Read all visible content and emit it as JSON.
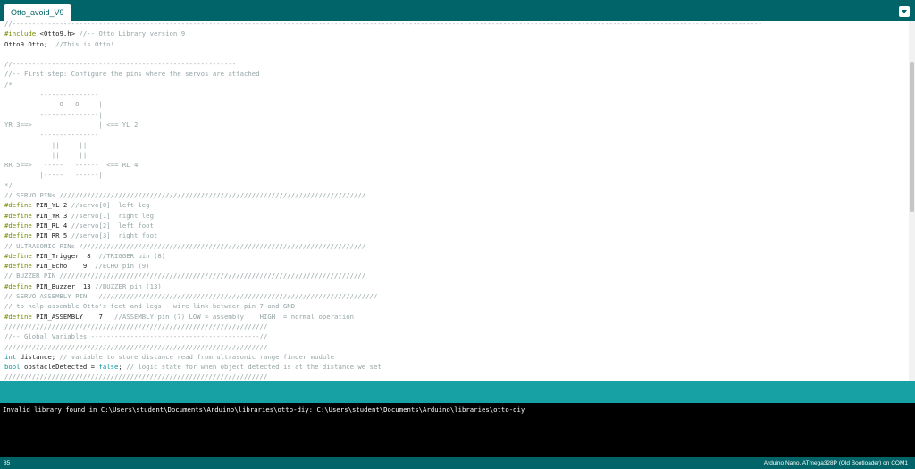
{
  "tab": {
    "title": "Otto_avoid_V9"
  },
  "editor": {
    "lines": [
      [
        {
          "t": "//-----------------------------------------------------------------------------------------------------------------------------------------------------------------------------------------------",
          "c": "cm"
        }
      ],
      [
        {
          "t": "#include ",
          "c": "kw"
        },
        {
          "t": "<Otto9.h>",
          "c": ""
        },
        {
          "t": " //-- Otto Library version 9",
          "c": "cm"
        }
      ],
      [
        {
          "t": "Otto9 Otto;  ",
          "c": ""
        },
        {
          "t": "//This is Otto!",
          "c": "cm"
        }
      ],
      [],
      [
        {
          "t": "//---------------------------------------------------------",
          "c": "cm"
        }
      ],
      [
        {
          "t": "//-- First step: Configure the pins where the servos are attached",
          "c": "cm"
        }
      ],
      [
        {
          "t": "/*",
          "c": "cm"
        }
      ],
      [
        {
          "t": "         ---------------",
          "c": "cm"
        }
      ],
      [
        {
          "t": "        |     O   O     |",
          "c": "cm"
        }
      ],
      [
        {
          "t": "        |---------------|",
          "c": "cm"
        }
      ],
      [
        {
          "t": "YR 3==> |               | <== YL 2",
          "c": "cm"
        }
      ],
      [
        {
          "t": "         ---------------",
          "c": "cm"
        }
      ],
      [
        {
          "t": "            ||     ||",
          "c": "cm"
        }
      ],
      [
        {
          "t": "            ||     ||",
          "c": "cm"
        }
      ],
      [
        {
          "t": "RR 5==>   -----   ------  <== RL 4",
          "c": "cm"
        }
      ],
      [
        {
          "t": "         |-----   ------|",
          "c": "cm"
        }
      ],
      [
        {
          "t": "*/",
          "c": "cm"
        }
      ],
      [
        {
          "t": "// SERVO PINs //////////////////////////////////////////////////////////////////////////////",
          "c": "cm"
        }
      ],
      [
        {
          "t": "#define ",
          "c": "kw"
        },
        {
          "t": "PIN_YL 2 ",
          "c": ""
        },
        {
          "t": "//servo[0]  left leg",
          "c": "cm"
        }
      ],
      [
        {
          "t": "#define ",
          "c": "kw"
        },
        {
          "t": "PIN_YR 3 ",
          "c": ""
        },
        {
          "t": "//servo[1]  right leg",
          "c": "cm"
        }
      ],
      [
        {
          "t": "#define ",
          "c": "kw"
        },
        {
          "t": "PIN_RL 4 ",
          "c": ""
        },
        {
          "t": "//servo[2]  left foot",
          "c": "cm"
        }
      ],
      [
        {
          "t": "#define ",
          "c": "kw"
        },
        {
          "t": "PIN_RR 5 ",
          "c": ""
        },
        {
          "t": "//servo[3]  right foot",
          "c": "cm"
        }
      ],
      [
        {
          "t": "// ULTRASONIC PINs /////////////////////////////////////////////////////////////////////////",
          "c": "cm"
        }
      ],
      [
        {
          "t": "#define ",
          "c": "kw"
        },
        {
          "t": "PIN_Trigger  8  ",
          "c": ""
        },
        {
          "t": "//TRIGGER pin (8)",
          "c": "cm"
        }
      ],
      [
        {
          "t": "#define ",
          "c": "kw"
        },
        {
          "t": "PIN_Echo    9  ",
          "c": ""
        },
        {
          "t": "//ECHO pin (9)",
          "c": "cm"
        }
      ],
      [
        {
          "t": "// BUZZER PIN //////////////////////////////////////////////////////////////////////////////",
          "c": "cm"
        }
      ],
      [
        {
          "t": "#define ",
          "c": "kw"
        },
        {
          "t": "PIN_Buzzer  13 ",
          "c": ""
        },
        {
          "t": "//BUZZER pin (13)",
          "c": "cm"
        }
      ],
      [
        {
          "t": "// SERVO ASSEMBLY PIN   ///////////////////////////////////////////////////////////////////////",
          "c": "cm"
        }
      ],
      [
        {
          "t": "// to help assemble Otto's feet and legs - wire link between pin 7 and GND",
          "c": "cm"
        }
      ],
      [
        {
          "t": "#define ",
          "c": "kw"
        },
        {
          "t": "PIN_ASSEMBLY    7   ",
          "c": ""
        },
        {
          "t": "//ASSEMBLY pin (7) LOW = assembly    HIGH  = normal operation",
          "c": "cm"
        }
      ],
      [
        {
          "t": "///////////////////////////////////////////////////////////////////",
          "c": "cm"
        }
      ],
      [
        {
          "t": "//-- Global Variables -------------------------------------------//",
          "c": "cm"
        }
      ],
      [
        {
          "t": "///////////////////////////////////////////////////////////////////",
          "c": "cm"
        }
      ],
      [
        {
          "t": "int ",
          "c": "ty"
        },
        {
          "t": "distance; ",
          "c": ""
        },
        {
          "t": "// variable to store distance read from ultrasonic range finder module",
          "c": "cm"
        }
      ],
      [
        {
          "t": "bool ",
          "c": "ty"
        },
        {
          "t": "obstacleDetected = ",
          "c": ""
        },
        {
          "t": "false",
          "c": "ct"
        },
        {
          "t": "; ",
          "c": ""
        },
        {
          "t": "// logic state for when object detected is at the distance we set",
          "c": "cm"
        }
      ],
      [
        {
          "t": "///////////////////////////////////////////////////////////////////",
          "c": "cm"
        }
      ]
    ]
  },
  "console": {
    "text": "Invalid library found in C:\\Users\\student\\Documents\\Arduino\\libraries\\otto-diy: C:\\Users\\student\\Documents\\Arduino\\libraries\\otto-diy"
  },
  "status": {
    "line": "85",
    "board": "Arduino Nano, ATmega328P (Old Bootloader) on COM1"
  },
  "colors": {
    "teal": "#17a1a5",
    "dark_teal": "#006468",
    "comment": "#95a5a6",
    "keyword": "#728e00",
    "type": "#00979c"
  }
}
